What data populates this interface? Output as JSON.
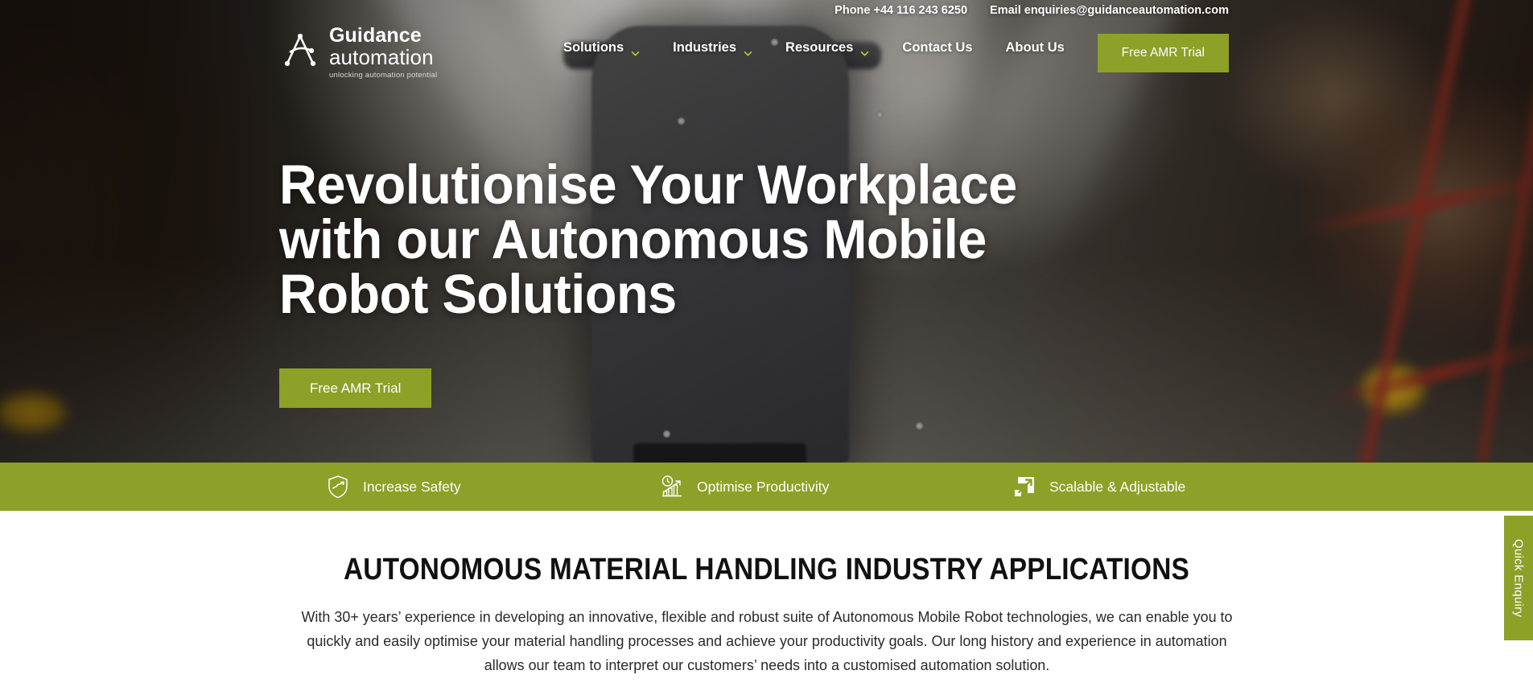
{
  "topbar": {
    "phone": "Phone +44 116 243 6250",
    "email": "Email enquiries@guidanceautomation.com"
  },
  "logo": {
    "line1": "Guidance",
    "line2": "automation",
    "tagline": "unlocking automation potential"
  },
  "nav": {
    "items": [
      {
        "label": "Solutions",
        "has_dropdown": true
      },
      {
        "label": "Industries",
        "has_dropdown": true
      },
      {
        "label": "Resources",
        "has_dropdown": true
      },
      {
        "label": "Contact Us",
        "has_dropdown": false
      },
      {
        "label": "About Us",
        "has_dropdown": false
      }
    ],
    "cta_label": "Free AMR Trial"
  },
  "hero": {
    "title": "Revolutionise Your Workplace with our Autonomous Mobile Robot Solutions",
    "cta_label": "Free AMR Trial"
  },
  "features": [
    {
      "label": "Increase Safety",
      "icon": "shield-chart-icon"
    },
    {
      "label": "Optimise Productivity",
      "icon": "clock-bar-chart-icon"
    },
    {
      "label": "Scalable & Adjustable",
      "icon": "expand-arrow-icon"
    }
  ],
  "main": {
    "title": "AUTONOMOUS MATERIAL HANDLING INDUSTRY APPLICATIONS",
    "body": "With 30+ years’ experience in developing an innovative, flexible and robust suite of Autonomous Mobile Robot technologies, we can enable you to quickly and easily optimise your material handling processes and achieve your productivity goals. Our long history and experience in automation allows our team to interpret our customers’ needs into a customised automation solution."
  },
  "side_tab": {
    "label": "Quick Enquiry"
  },
  "colors": {
    "brand_green": "#8da028",
    "text_dark": "#111111",
    "white": "#ffffff"
  }
}
